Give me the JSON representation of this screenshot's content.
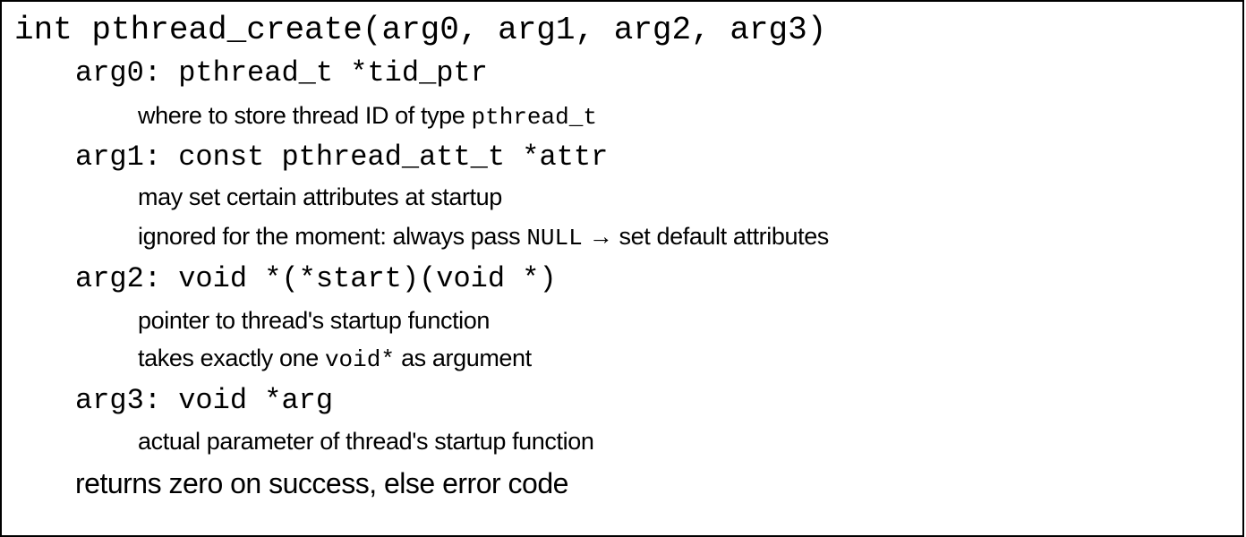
{
  "signature": "int pthread_create(arg0, arg1, arg2, arg3)",
  "args": [
    {
      "decl": "arg0: pthread_t *tid_ptr",
      "notes": [
        {
          "text": "where to store thread ID of type",
          "code": "pthread_t",
          "after": ""
        }
      ]
    },
    {
      "decl": "arg1: const pthread_att_t *attr",
      "notes": [
        {
          "text": "may set certain attributes at startup",
          "code": "",
          "after": ""
        },
        {
          "text": "ignored for the moment: always pass",
          "code": "NULL",
          "after": "→ set default attributes"
        }
      ]
    },
    {
      "decl": "arg2: void *(*start)(void *)",
      "notes": [
        {
          "text": "pointer to thread's startup function",
          "code": "",
          "after": ""
        },
        {
          "text": "takes exactly one",
          "code": "void*",
          "after": "as argument"
        }
      ]
    },
    {
      "decl": "arg3: void *arg",
      "notes": [
        {
          "text": "actual parameter of thread's startup function",
          "code": "",
          "after": ""
        }
      ]
    }
  ],
  "returns": "returns zero on success, else error code"
}
